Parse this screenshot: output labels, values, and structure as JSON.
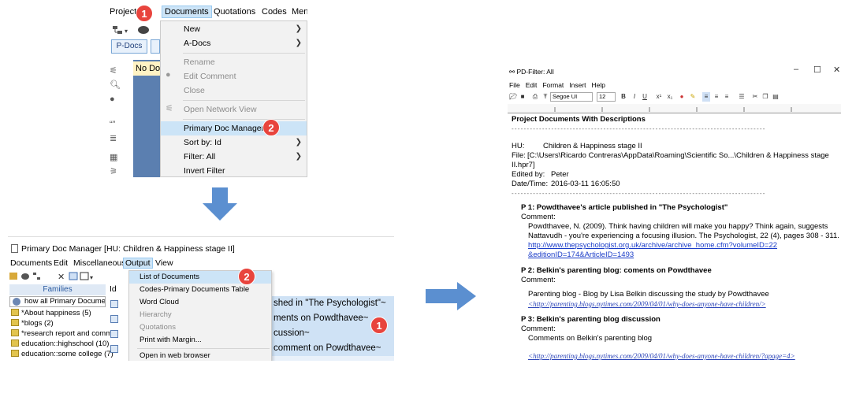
{
  "panel1": {
    "menubar": [
      "Project",
      "Documents",
      "Quotations",
      "Codes",
      "Men"
    ],
    "pdocs_label": "P-Docs",
    "no_doc_label": "No Do",
    "menu_items": [
      {
        "label": "New",
        "disabled": false,
        "submenu": true
      },
      {
        "label": "A-Docs",
        "disabled": false,
        "submenu": true
      },
      {
        "label": "Rename",
        "disabled": true,
        "submenu": false
      },
      {
        "label": "Edit Comment",
        "disabled": true,
        "submenu": false
      },
      {
        "label": "Close",
        "disabled": true,
        "submenu": false
      },
      {
        "label": "Open Network View",
        "disabled": true,
        "submenu": false
      },
      {
        "label": "Primary Doc Manager",
        "disabled": false,
        "submenu": false,
        "highlighted": true
      },
      {
        "label": "Sort by: Id",
        "disabled": false,
        "submenu": true
      },
      {
        "label": "Filter: All",
        "disabled": false,
        "submenu": true
      },
      {
        "label": "Invert Filter",
        "disabled": false,
        "submenu": false
      }
    ],
    "badge_1": "1",
    "badge_2": "2"
  },
  "panel2": {
    "title": "Primary Doc Manager [HU: Children & Happiness stage II]",
    "menubar": [
      "Documents",
      "Edit",
      "Miscellaneous",
      "Output",
      "View"
    ],
    "families_header": "Families",
    "show_all": "how all Primary Document",
    "families": [
      "*About happiness (5)",
      "*blogs (2)",
      "*research report and comme",
      "education::highschool (10)",
      "education::some college (7)"
    ],
    "column_header": "Id",
    "content_rows": [
      "shed in \"The Psychologist\"~",
      "ments on Powdthavee~",
      "cussion~",
      "comment on Powdthavee~"
    ],
    "output_menu": [
      {
        "label": "List of Documents",
        "disabled": false,
        "highlighted": true
      },
      {
        "label": "Codes-Primary Documents Table",
        "disabled": false
      },
      {
        "label": "Word Cloud",
        "disabled": false
      },
      {
        "label": "Hierarchy",
        "disabled": true
      },
      {
        "label": "Quotations",
        "disabled": true
      },
      {
        "label": "Print with Margin...",
        "disabled": false
      },
      {
        "label": "Open in web browser",
        "disabled": false
      }
    ],
    "badge_1": "1",
    "badge_2": "2"
  },
  "panel3": {
    "window_title": "PD-Filter: All",
    "menubar": [
      "File",
      "Edit",
      "Format",
      "Insert",
      "Help"
    ],
    "font_name": "Segoe UI",
    "font_size": "12",
    "heading": "Project Documents With Descriptions",
    "hu_label": "HU:",
    "hu_value": "Children & Happiness stage II",
    "file_label": "File:",
    "file_value": "[C:\\Users\\Ricardo Contreras\\AppData\\Roaming\\Scientific So...\\Children & Happiness stage",
    "file_value_cont": "II.hpr7]",
    "edited_label": "Edited by:",
    "edited_value": "Peter",
    "date_label": "Date/Time:",
    "date_value": "2016-03-11 16:05:50",
    "comment_label": "Comment:",
    "p1_title": "P 1: Powdthavee's article published in \"The Psychologist\"",
    "p1_text": "Powdthavee, N. (2009). Think having children will make you happy? Think again, suggests Nattavudh - you're experiencing a focusing illusion. The Psychologist, 22 (4), pages 308 - 311.",
    "p1_link": "http://www.thepsychologist.org.uk/archive/archive_home.cfm?volumeID=22",
    "p1_link_cont": "&editionID=174&ArticleID=1493",
    "p2_title": "P 2: Belkin's parenting blog: coments on Powdthavee",
    "p2_text": "Parenting blog - Blog by Lisa Belkin discussing the study by Powdthavee",
    "p2_link": "<http://parenting.blogs.nytimes.com/2009/04/01/why-does-anyone-have-children/>",
    "p3_title": "P 3: Belkin's parenting blog discussion",
    "p3_text": "Comments on Belkin's parenting blog",
    "p3_link": "<http://parenting.blogs.nytimes.com/2009/04/01/why-does-anyone-have-children/?apage=4>"
  },
  "colors": {
    "badge": "#e8443d",
    "arrow": "#5b8fd0",
    "highlight": "#cce4f7",
    "link": "#1a3cc8"
  }
}
